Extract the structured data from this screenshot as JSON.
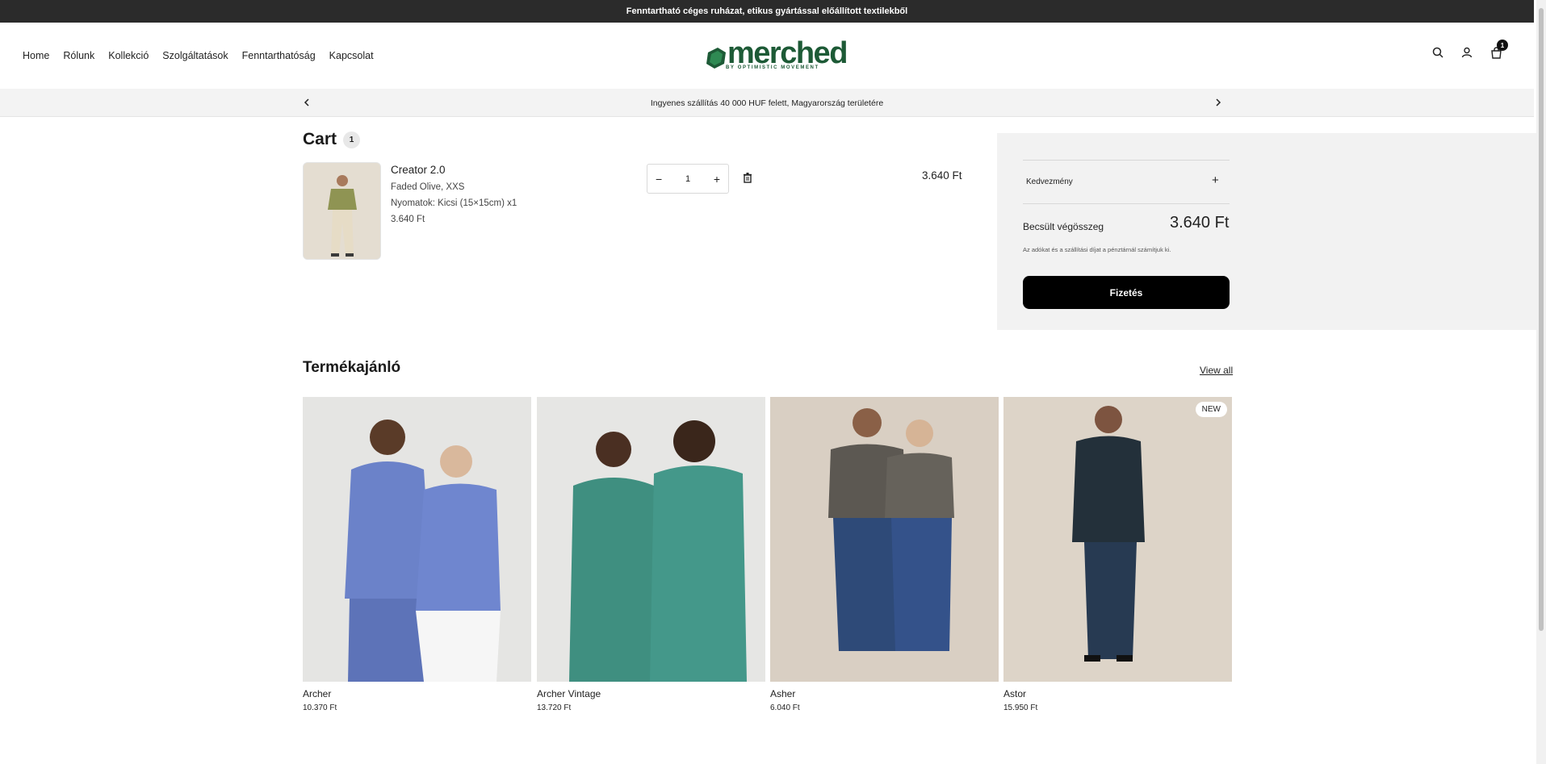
{
  "announcement": "Fenntartható céges ruházat, etikus gyártással előállított textilekből",
  "nav": [
    "Home",
    "Rólunk",
    "Kollekció",
    "Szolgáltatások",
    "Fenntarthatóság",
    "Kapcsolat"
  ],
  "logo": {
    "word": "merched",
    "sub": "BY OPTIMISTIC MOVEMENT",
    "color": "#1d5a36"
  },
  "header_icons": [
    "search-icon",
    "account-icon",
    "cart-icon"
  ],
  "cart_count": "1",
  "promo": {
    "text": "Ingyenes szállítás 40 000 HUF felett, Magyarország területére"
  },
  "cart": {
    "title": "Cart",
    "count": "1",
    "item": {
      "name": "Creator 2.0",
      "variant": "Faded Olive, XXS",
      "print": "Nyomatok: Kicsi (15×15cm) x1",
      "price": "3.640 Ft",
      "quantity": "1",
      "total": "3.640 Ft"
    }
  },
  "summary": {
    "discount_label": "Kedvezmény",
    "estimated_label": "Becsült végösszeg",
    "estimated_value": "3.640 Ft",
    "tax_note": "Az adókat és a szállítási díjat a pénztárnál számítjuk ki.",
    "checkout_label": "Fizetés"
  },
  "recommendations": {
    "title": "Termékajánló",
    "view_all": "View all",
    "products": [
      {
        "name": "Archer",
        "price": "10.370 Ft",
        "color": "#6b82c9"
      },
      {
        "name": "Archer Vintage",
        "price": "13.720 Ft",
        "color": "#3f8f80"
      },
      {
        "name": "Asher",
        "price": "6.040 Ft",
        "color": "#5c5852"
      },
      {
        "name": "Astor",
        "price": "15.950 Ft",
        "color": "#23303a",
        "badge": "NEW"
      }
    ]
  }
}
